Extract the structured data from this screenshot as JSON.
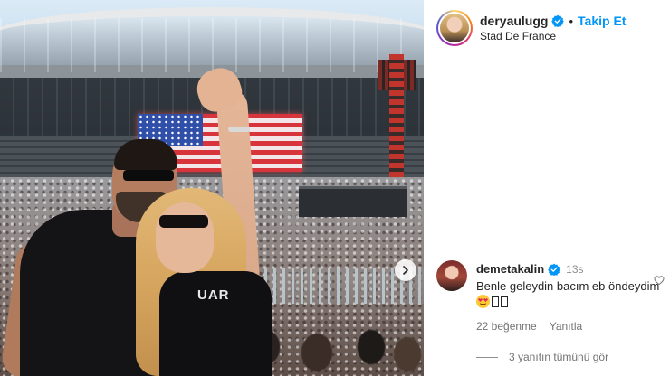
{
  "post": {
    "username": "deryaulugg",
    "follow_label": "Takip Et",
    "separator": "•",
    "location": "Stad De France",
    "photo_shirt_text": "UAR"
  },
  "comment": {
    "username": "demetakalin",
    "time": "13s",
    "text": "Benle geleydin bacım eb öndeydim",
    "likes": "22 beğenme",
    "reply_label": "Yanıtla",
    "view_replies": "3 yanıtın tümünü gör"
  },
  "colors": {
    "accent_blue": "#0095f6",
    "verified_blue": "#0095f6",
    "secondary_text": "#737373"
  },
  "icons": [
    "verified-badge-icon",
    "chevron-right-icon",
    "heart-icon",
    "heart-eyes-emoji"
  ]
}
